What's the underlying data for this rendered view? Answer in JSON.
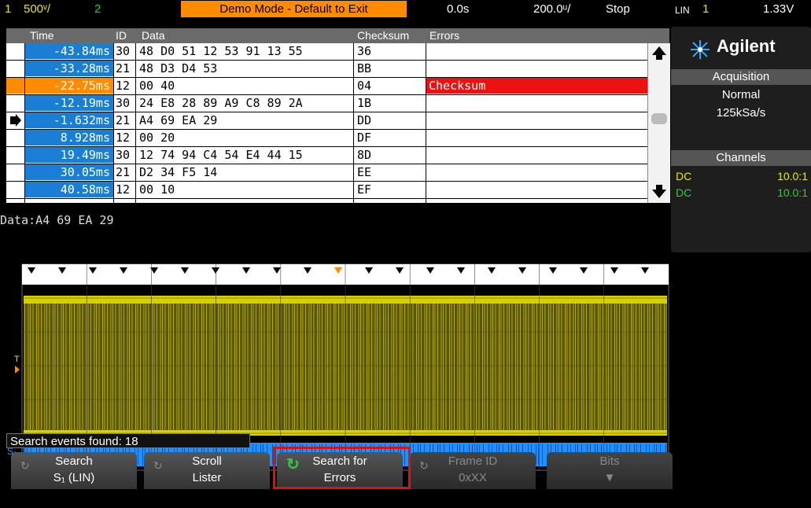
{
  "top": {
    "channel": "1",
    "volts_div": "500ᵛ/",
    "ch2": "2",
    "demo": "Demo Mode - Default to Exit",
    "time_offset": "0.0s",
    "time_div": "200.0ᵘ/",
    "run_state": "Stop",
    "trigger_mode": "LIN",
    "trigger_ch": "1",
    "trigger_level": "1.33V"
  },
  "lister": {
    "headers": [
      "Time",
      "ID",
      "Data",
      "Checksum",
      "Errors"
    ],
    "rows": [
      {
        "time": "-43.84ms",
        "id": "30",
        "data": "48 D0 51 12 53 91 13 55",
        "checksum": "36",
        "error": ""
      },
      {
        "time": "-33.28ms",
        "id": "21",
        "data": "48 D3 D4 53",
        "checksum": "BB",
        "error": ""
      },
      {
        "time": "-22.75ms",
        "id": "12",
        "data": "00 40",
        "checksum": "04",
        "error": "Checksum"
      },
      {
        "time": "-12.19ms",
        "id": "30",
        "data": "24 E8 28 89 A9 C8 89 2A",
        "checksum": "1B",
        "error": ""
      },
      {
        "time": "-1.632ms",
        "id": "21",
        "data": "A4 69 EA 29",
        "checksum": "DD",
        "error": ""
      },
      {
        "time": "8.928ms",
        "id": "12",
        "data": "00 20",
        "checksum": "DF",
        "error": ""
      },
      {
        "time": "19.49ms",
        "id": "30",
        "data": "12 74 94 C4 54 E4 44 15",
        "checksum": "8D",
        "error": ""
      },
      {
        "time": "30.05ms",
        "id": "21",
        "data": "D2 34 F5 14",
        "checksum": "EE",
        "error": ""
      },
      {
        "time": "40.58ms",
        "id": "12",
        "data": "00 10",
        "checksum": "EF",
        "error": ""
      }
    ]
  },
  "data_line": "Data:A4 69 EA 29",
  "search_events": "Search events found: 18",
  "softkeys": [
    {
      "l1": "Search",
      "l2": "S₁ (LIN)",
      "enabled": true
    },
    {
      "l1": "Scroll",
      "l2": "Lister",
      "enabled": true
    },
    {
      "l1": "Search for",
      "l2": "Errors",
      "enabled": true
    },
    {
      "l1": "Frame ID",
      "l2": "0xXX",
      "enabled": false
    },
    {
      "l1": "Bits",
      "l2": "▼",
      "enabled": false
    }
  ],
  "panel": {
    "brand": "Agilent",
    "acq_head": "Acquisition",
    "acq_mode": "Normal",
    "acq_rate": "125kSa/s",
    "ch_head": "Channels",
    "channels": [
      {
        "coupling": "DC",
        "probe": "10.0:1",
        "color": "#e8e800"
      },
      {
        "coupling": "DC",
        "probe": "10.0:1",
        "color": "#33cc33"
      }
    ]
  },
  "wave_labels": {
    "trig": "T",
    "ch1": "1",
    "s1": "S₁"
  },
  "colors": {
    "ch1": "#d8d000",
    "serial": "#1e90ff",
    "highlight": "#ff8c00",
    "error": "#ee1111",
    "time_cell": "#1a7fd4"
  }
}
